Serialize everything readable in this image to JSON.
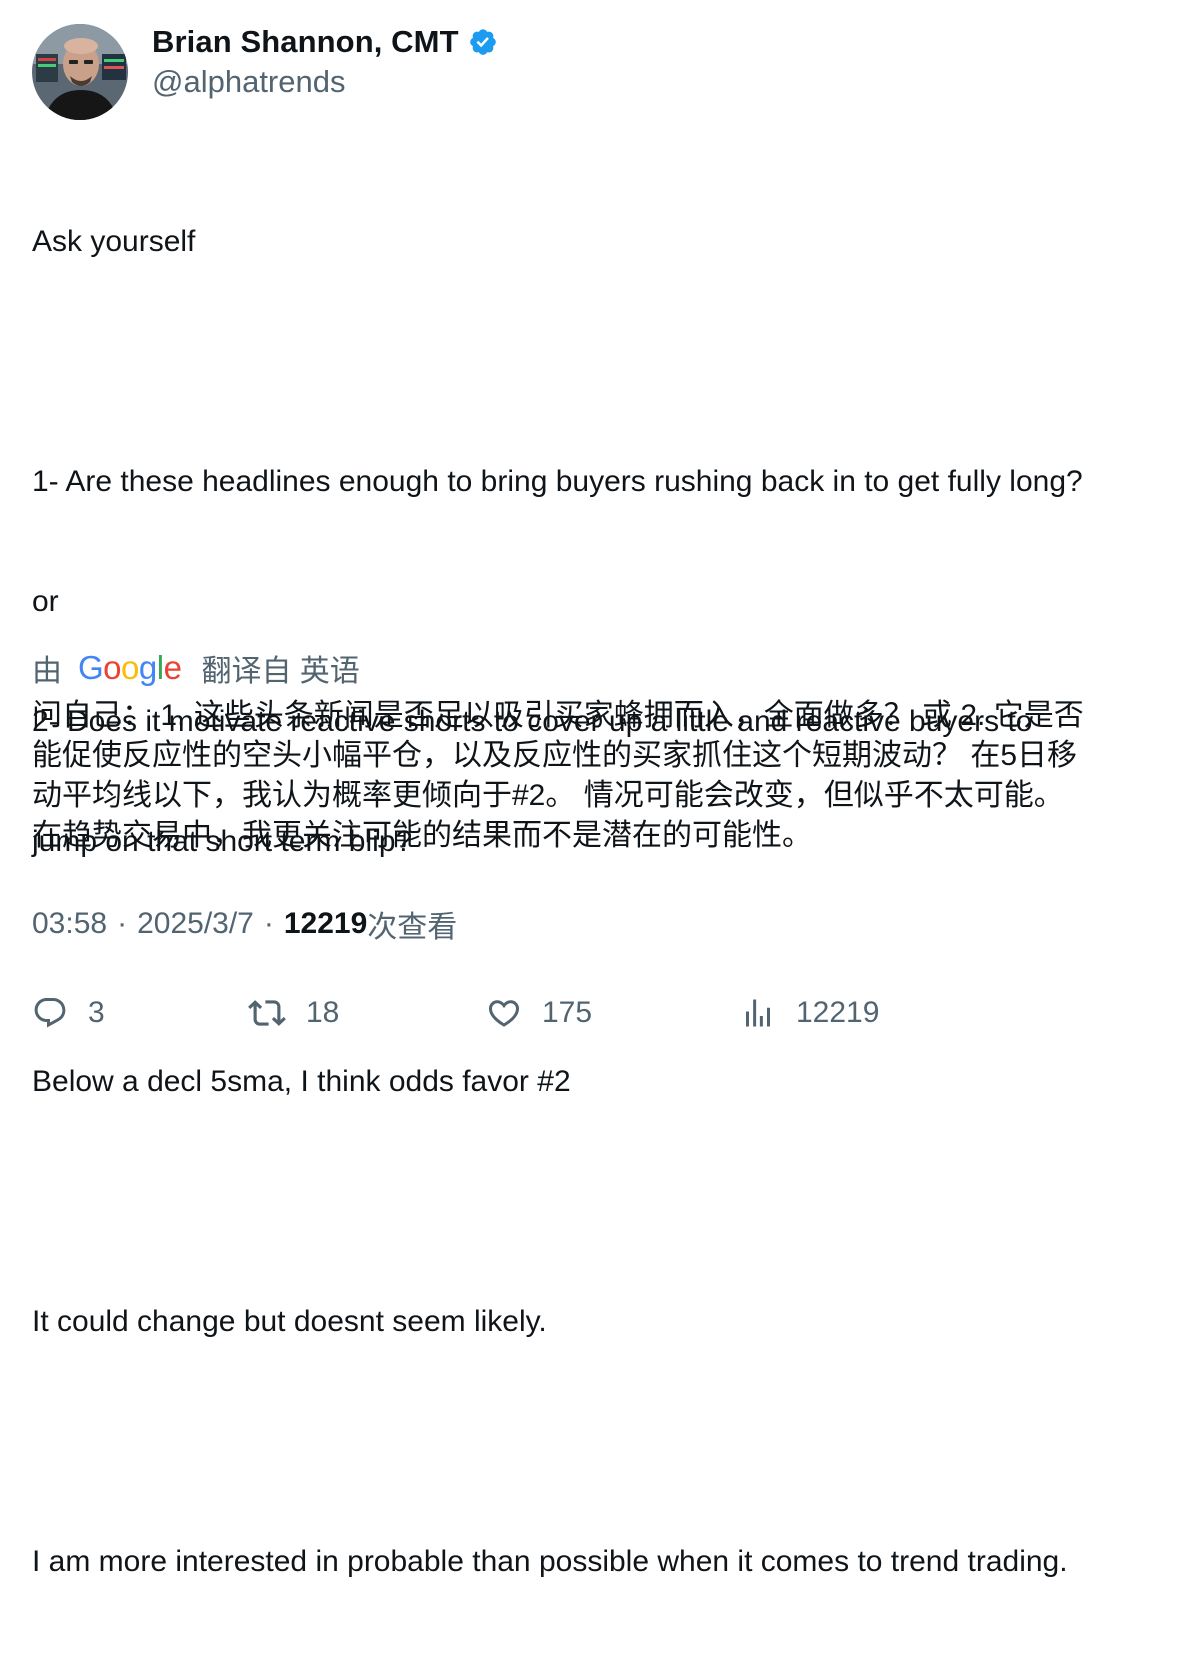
{
  "author": {
    "display_name": "Brian Shannon, CMT",
    "handle": "@alphatrends",
    "verified_color": "#1d9bf0"
  },
  "tweet": {
    "lines": [
      "Ask yourself",
      "",
      "1- Are these headlines enough to bring buyers rushing back in to get fully long?",
      "or",
      "2- Does it motivate reactive shorts to cover up a little and reactive buyers to",
      "jump on that short term blip?",
      "",
      "Below a decl 5sma, I think odds favor #2",
      "",
      "It could change but doesnt seem likely.",
      "",
      "I am more interested in probable than possible when it comes to trend trading."
    ]
  },
  "translation": {
    "prefix": "由",
    "provider": "Google",
    "suffix": "翻译自 英语",
    "lines": [
      "问自己： 1. 这些头条新闻是否足以吸引买家蜂拥而入，全面做多？ 或 2. 它是否",
      "能促使反应性的空头小幅平仓，以及反应性的买家抓住这个短期波动？ 在5日移",
      "动平均线以下，我认为概率更倾向于#2。 情况可能会改变，但似乎不太可能。",
      "在趋势交易中，我更关注可能的结果而不是潜在的可能性。"
    ]
  },
  "meta": {
    "time": "03:58",
    "date": "2025/3/7",
    "views_count": "12219",
    "views_label": "次查看",
    "separator": "·"
  },
  "actions": {
    "replies": "3",
    "reposts": "18",
    "likes": "175",
    "views": "12219"
  },
  "icons": {
    "reply": "reply-icon",
    "repost": "repost-icon",
    "like": "heart-icon",
    "views": "bar-chart-icon",
    "verified": "verified-badge-icon"
  }
}
